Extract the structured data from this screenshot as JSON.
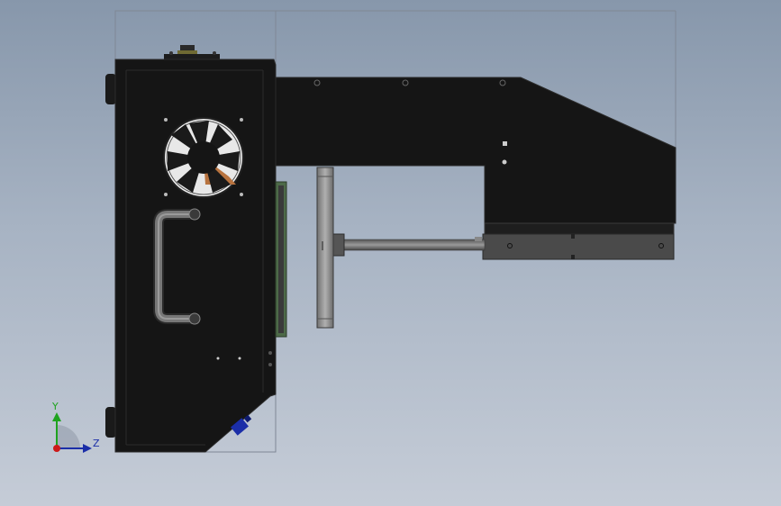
{
  "viewport": {
    "background_top": "#8797ab",
    "background_bottom": "#c5ccd7",
    "model_color": "#141414",
    "fan_blade_color": "#1a1a1a",
    "accent_orange": "#b8733f",
    "accent_blue": "#1b2ea8"
  },
  "triad": {
    "y_label": "Y",
    "z_label": "Z",
    "y_color": "#1fa31f",
    "z_color": "#1b2ea8",
    "x_color": "#cc1a1a",
    "icon": "coordinate-triad-icon"
  },
  "model": {
    "name_icon": "3d-assembly-side-view"
  }
}
